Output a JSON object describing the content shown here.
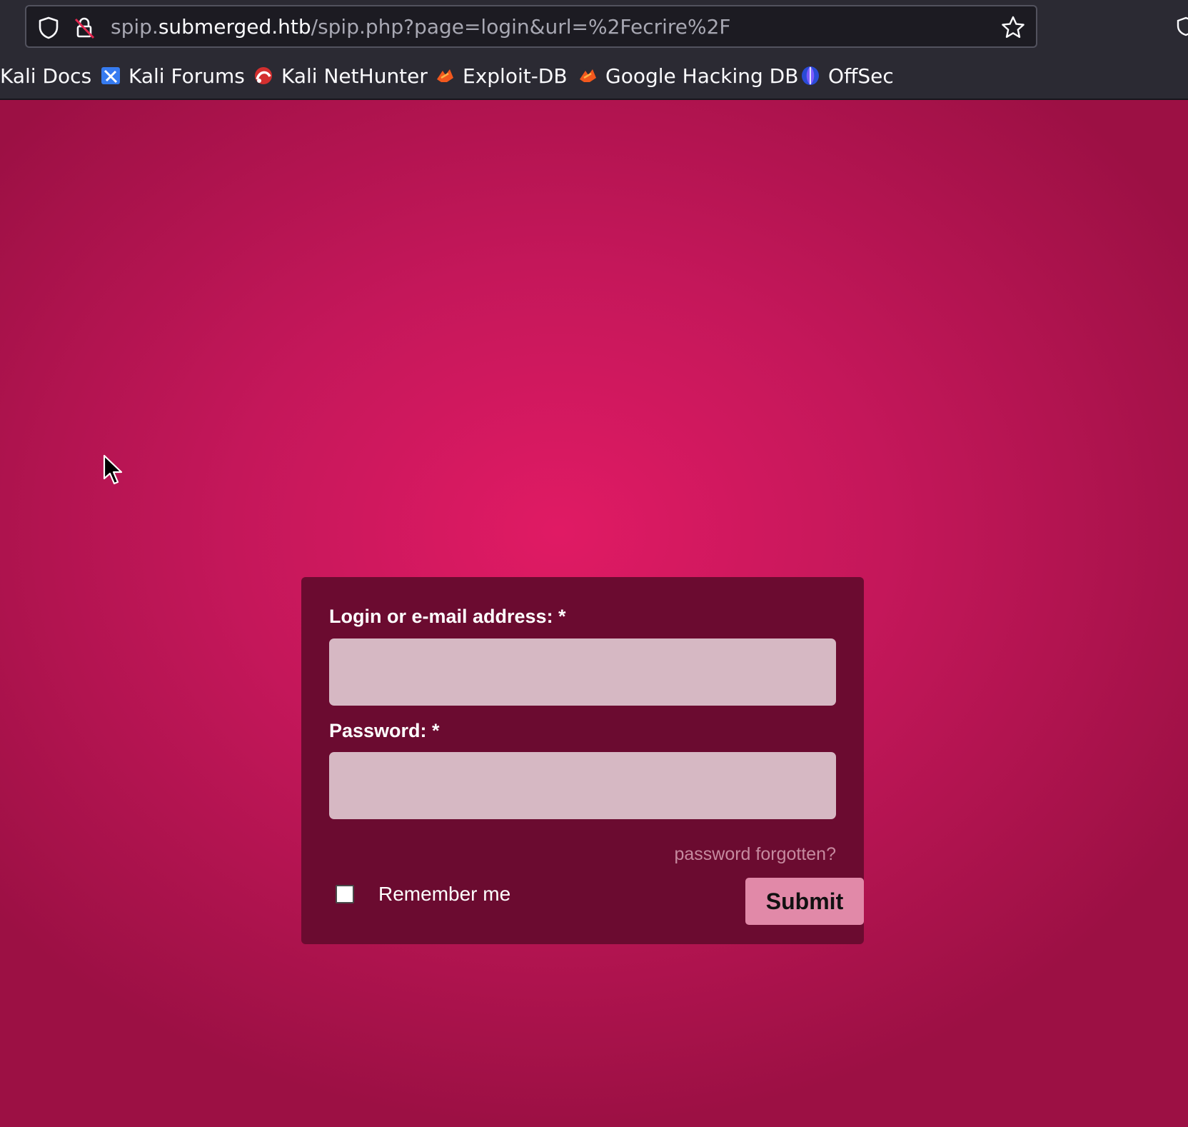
{
  "browser": {
    "url": {
      "prefix": "spip.",
      "host": "submerged.htb",
      "path": "/spip.php?page=login&url=%2Fecrire%2F"
    },
    "bookmarks": [
      {
        "label": "Kali Docs",
        "icon": "kali-docs-icon"
      },
      {
        "label": "Kali Forums",
        "icon": "kali-forums-icon"
      },
      {
        "label": "Kali NetHunter",
        "icon": "kali-nethunter-icon"
      },
      {
        "label": "Exploit-DB",
        "icon": "exploit-db-icon"
      },
      {
        "label": "Google Hacking DB",
        "icon": "ghdb-icon"
      },
      {
        "label": "OffSec",
        "icon": "offsec-icon"
      }
    ]
  },
  "login_form": {
    "login_label": "Login or e-mail address: *",
    "login_value": "",
    "password_label": "Password: *",
    "password_value": "",
    "forgot_link": "password forgotten?",
    "remember_label": "Remember me",
    "remember_checked": false,
    "submit_label": "Submit"
  },
  "colors": {
    "background_center": "#e01a64",
    "background_edge": "#9c1044",
    "panel": "#6b0b30",
    "field": "#d6b8c3",
    "submit": "#e189a8",
    "link": "#c68a9f"
  }
}
